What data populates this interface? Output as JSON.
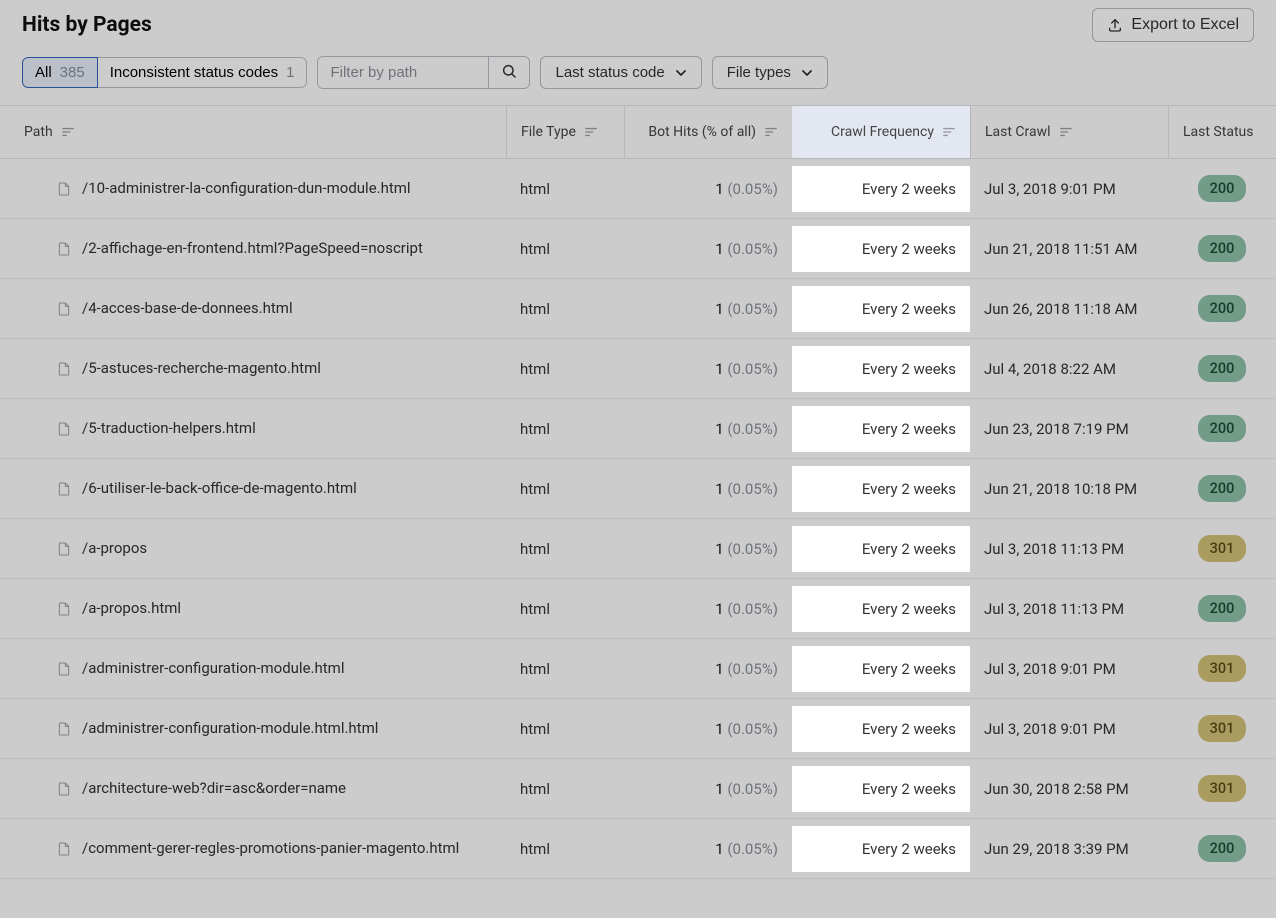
{
  "header": {
    "title": "Hits by Pages",
    "export_label": "Export to Excel"
  },
  "filters": {
    "segments": [
      {
        "label": "All",
        "count": "385",
        "active": true
      },
      {
        "label": "Inconsistent status codes",
        "count": "1",
        "active": false
      }
    ],
    "search_placeholder": "Filter by path",
    "dropdowns": [
      {
        "label": "Last status code"
      },
      {
        "label": "File types"
      }
    ]
  },
  "columns": {
    "path": "Path",
    "file_type": "File Type",
    "bot_hits": "Bot Hits (% of all)",
    "crawl_frequency": "Crawl Frequency",
    "last_crawl": "Last Crawl",
    "last_status": "Last Status"
  },
  "rows": [
    {
      "path": "/10-administrer-la-configuration-dun-module.html",
      "file_type": "html",
      "hits": "1",
      "pct": "(0.05%)",
      "freq": "Every 2 weeks",
      "last": "Jul 3, 2018 9:01 PM",
      "status": "200"
    },
    {
      "path": "/2-affichage-en-frontend.html?PageSpeed=noscript",
      "file_type": "html",
      "hits": "1",
      "pct": "(0.05%)",
      "freq": "Every 2 weeks",
      "last": "Jun 21, 2018 11:51 AM",
      "status": "200"
    },
    {
      "path": "/4-acces-base-de-donnees.html",
      "file_type": "html",
      "hits": "1",
      "pct": "(0.05%)",
      "freq": "Every 2 weeks",
      "last": "Jun 26, 2018 11:18 AM",
      "status": "200"
    },
    {
      "path": "/5-astuces-recherche-magento.html",
      "file_type": "html",
      "hits": "1",
      "pct": "(0.05%)",
      "freq": "Every 2 weeks",
      "last": "Jul 4, 2018 8:22 AM",
      "status": "200"
    },
    {
      "path": "/5-traduction-helpers.html",
      "file_type": "html",
      "hits": "1",
      "pct": "(0.05%)",
      "freq": "Every 2 weeks",
      "last": "Jun 23, 2018 7:19 PM",
      "status": "200"
    },
    {
      "path": "/6-utiliser-le-back-office-de-magento.html",
      "file_type": "html",
      "hits": "1",
      "pct": "(0.05%)",
      "freq": "Every 2 weeks",
      "last": "Jun 21, 2018 10:18 PM",
      "status": "200"
    },
    {
      "path": "/a-propos",
      "file_type": "html",
      "hits": "1",
      "pct": "(0.05%)",
      "freq": "Every 2 weeks",
      "last": "Jul 3, 2018 11:13 PM",
      "status": "301"
    },
    {
      "path": "/a-propos.html",
      "file_type": "html",
      "hits": "1",
      "pct": "(0.05%)",
      "freq": "Every 2 weeks",
      "last": "Jul 3, 2018 11:13 PM",
      "status": "200"
    },
    {
      "path": "/administrer-configuration-module.html",
      "file_type": "html",
      "hits": "1",
      "pct": "(0.05%)",
      "freq": "Every 2 weeks",
      "last": "Jul 3, 2018 9:01 PM",
      "status": "301"
    },
    {
      "path": "/administrer-configuration-module.html.html",
      "file_type": "html",
      "hits": "1",
      "pct": "(0.05%)",
      "freq": "Every 2 weeks",
      "last": "Jul 3, 2018 9:01 PM",
      "status": "301"
    },
    {
      "path": "/architecture-web?dir=asc&order=name",
      "file_type": "html",
      "hits": "1",
      "pct": "(0.05%)",
      "freq": "Every 2 weeks",
      "last": "Jun 30, 2018 2:58 PM",
      "status": "301"
    },
    {
      "path": "/comment-gerer-regles-promotions-panier-magento.html",
      "file_type": "html",
      "hits": "1",
      "pct": "(0.05%)",
      "freq": "Every 2 weeks",
      "last": "Jun 29, 2018 3:39 PM",
      "status": "200"
    }
  ],
  "status_colors": {
    "200": "s200",
    "301": "s301"
  }
}
